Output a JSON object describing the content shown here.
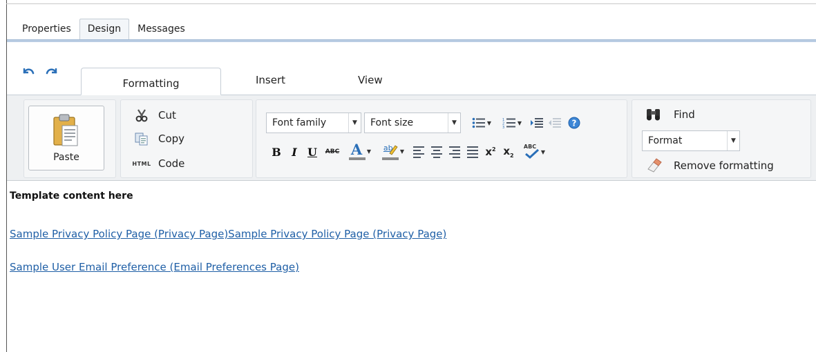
{
  "top_tabs": [
    {
      "label": "Properties",
      "active": false
    },
    {
      "label": "Design",
      "active": true
    },
    {
      "label": "Messages",
      "active": false
    }
  ],
  "ribbon_tabs": {
    "formatting": "Formatting",
    "insert": "Insert",
    "view": "View",
    "active": "Formatting"
  },
  "clipboard": {
    "paste": "Paste",
    "cut": "Cut",
    "copy": "Copy",
    "code": "Code",
    "code_icon_text": "HTML"
  },
  "font_group": {
    "font_family": "Font family",
    "font_size": "Font size",
    "bold": "B",
    "italic": "I",
    "underline": "U",
    "strike": "ABC",
    "font_color": "A",
    "highlight": "ab",
    "spell": "ABC"
  },
  "editing": {
    "find": "Find",
    "format": "Format",
    "remove_formatting": "Remove formatting"
  },
  "content": {
    "heading": "Template content here",
    "link1": "Sample Privacy Policy Page (Privacy Page)Sample Privacy Policy Page (Privacy Page)",
    "link2": "Sample User Email Preference (Email Preferences Page)"
  },
  "colors": {
    "link": "#1f5fa6",
    "tab_line": "#b9cce3",
    "ribbon_bg": "#eef0f2",
    "font_color_bar": "#888888"
  }
}
